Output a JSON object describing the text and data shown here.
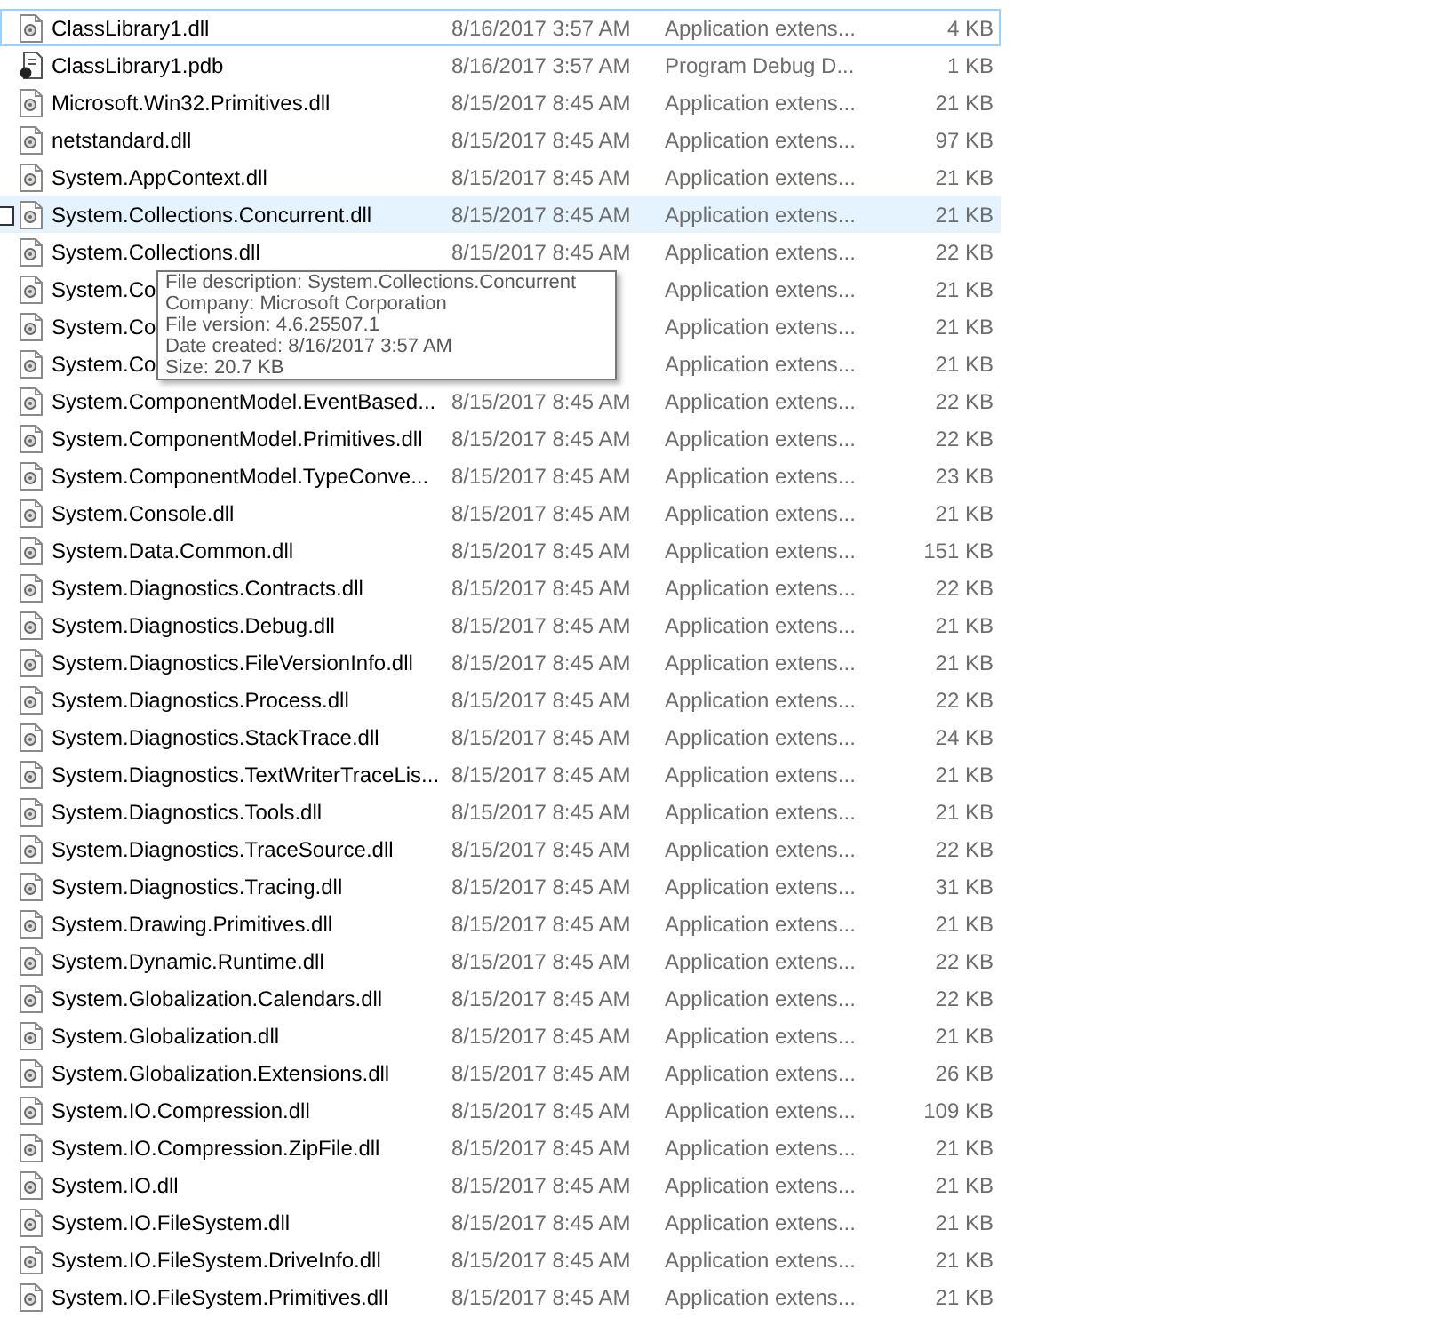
{
  "files": [
    {
      "kind": "dll",
      "name": "ClassLibrary1.dll",
      "date": "8/16/2017 3:57 AM",
      "type": "Application extens...",
      "size": "4 KB",
      "focused": true,
      "hovered": false
    },
    {
      "kind": "pdb",
      "name": "ClassLibrary1.pdb",
      "date": "8/16/2017 3:57 AM",
      "type": "Program Debug D...",
      "size": "1 KB",
      "focused": false,
      "hovered": false
    },
    {
      "kind": "dll",
      "name": "Microsoft.Win32.Primitives.dll",
      "date": "8/15/2017 8:45 AM",
      "type": "Application extens...",
      "size": "21 KB",
      "focused": false,
      "hovered": false
    },
    {
      "kind": "dll",
      "name": "netstandard.dll",
      "date": "8/15/2017 8:45 AM",
      "type": "Application extens...",
      "size": "97 KB",
      "focused": false,
      "hovered": false
    },
    {
      "kind": "dll",
      "name": "System.AppContext.dll",
      "date": "8/15/2017 8:45 AM",
      "type": "Application extens...",
      "size": "21 KB",
      "focused": false,
      "hovered": false
    },
    {
      "kind": "dll",
      "name": "System.Collections.Concurrent.dll",
      "date": "8/15/2017 8:45 AM",
      "type": "Application extens...",
      "size": "21 KB",
      "focused": false,
      "hovered": true
    },
    {
      "kind": "dll",
      "name": "System.Collections.dll",
      "date": "8/15/2017 8:45 AM",
      "type": "Application extens...",
      "size": "22 KB",
      "focused": false,
      "hovered": false
    },
    {
      "kind": "dll",
      "name": "System.Co",
      "type": "Application extens...",
      "size": "21 KB",
      "focused": false,
      "hovered": false
    },
    {
      "kind": "dll",
      "name": "System.Co",
      "type": "Application extens...",
      "size": "21 KB",
      "focused": false,
      "hovered": false
    },
    {
      "kind": "dll",
      "name": "System.Co",
      "type": "Application extens...",
      "size": "21 KB",
      "focused": false,
      "hovered": false
    },
    {
      "kind": "dll",
      "name": "System.ComponentModel.EventBased...",
      "date": "8/15/2017 8:45 AM",
      "type": "Application extens...",
      "size": "22 KB",
      "focused": false,
      "hovered": false
    },
    {
      "kind": "dll",
      "name": "System.ComponentModel.Primitives.dll",
      "date": "8/15/2017 8:45 AM",
      "type": "Application extens...",
      "size": "22 KB",
      "focused": false,
      "hovered": false
    },
    {
      "kind": "dll",
      "name": "System.ComponentModel.TypeConve...",
      "date": "8/15/2017 8:45 AM",
      "type": "Application extens...",
      "size": "23 KB",
      "focused": false,
      "hovered": false
    },
    {
      "kind": "dll",
      "name": "System.Console.dll",
      "date": "8/15/2017 8:45 AM",
      "type": "Application extens...",
      "size": "21 KB",
      "focused": false,
      "hovered": false
    },
    {
      "kind": "dll",
      "name": "System.Data.Common.dll",
      "date": "8/15/2017 8:45 AM",
      "type": "Application extens...",
      "size": "151 KB",
      "focused": false,
      "hovered": false
    },
    {
      "kind": "dll",
      "name": "System.Diagnostics.Contracts.dll",
      "date": "8/15/2017 8:45 AM",
      "type": "Application extens...",
      "size": "22 KB",
      "focused": false,
      "hovered": false
    },
    {
      "kind": "dll",
      "name": "System.Diagnostics.Debug.dll",
      "date": "8/15/2017 8:45 AM",
      "type": "Application extens...",
      "size": "21 KB",
      "focused": false,
      "hovered": false
    },
    {
      "kind": "dll",
      "name": "System.Diagnostics.FileVersionInfo.dll",
      "date": "8/15/2017 8:45 AM",
      "type": "Application extens...",
      "size": "21 KB",
      "focused": false,
      "hovered": false
    },
    {
      "kind": "dll",
      "name": "System.Diagnostics.Process.dll",
      "date": "8/15/2017 8:45 AM",
      "type": "Application extens...",
      "size": "22 KB",
      "focused": false,
      "hovered": false
    },
    {
      "kind": "dll",
      "name": "System.Diagnostics.StackTrace.dll",
      "date": "8/15/2017 8:45 AM",
      "type": "Application extens...",
      "size": "24 KB",
      "focused": false,
      "hovered": false
    },
    {
      "kind": "dll",
      "name": "System.Diagnostics.TextWriterTraceLis...",
      "date": "8/15/2017 8:45 AM",
      "type": "Application extens...",
      "size": "21 KB",
      "focused": false,
      "hovered": false
    },
    {
      "kind": "dll",
      "name": "System.Diagnostics.Tools.dll",
      "date": "8/15/2017 8:45 AM",
      "type": "Application extens...",
      "size": "21 KB",
      "focused": false,
      "hovered": false
    },
    {
      "kind": "dll",
      "name": "System.Diagnostics.TraceSource.dll",
      "date": "8/15/2017 8:45 AM",
      "type": "Application extens...",
      "size": "22 KB",
      "focused": false,
      "hovered": false
    },
    {
      "kind": "dll",
      "name": "System.Diagnostics.Tracing.dll",
      "date": "8/15/2017 8:45 AM",
      "type": "Application extens...",
      "size": "31 KB",
      "focused": false,
      "hovered": false
    },
    {
      "kind": "dll",
      "name": "System.Drawing.Primitives.dll",
      "date": "8/15/2017 8:45 AM",
      "type": "Application extens...",
      "size": "21 KB",
      "focused": false,
      "hovered": false
    },
    {
      "kind": "dll",
      "name": "System.Dynamic.Runtime.dll",
      "date": "8/15/2017 8:45 AM",
      "type": "Application extens...",
      "size": "22 KB",
      "focused": false,
      "hovered": false
    },
    {
      "kind": "dll",
      "name": "System.Globalization.Calendars.dll",
      "date": "8/15/2017 8:45 AM",
      "type": "Application extens...",
      "size": "22 KB",
      "focused": false,
      "hovered": false
    },
    {
      "kind": "dll",
      "name": "System.Globalization.dll",
      "date": "8/15/2017 8:45 AM",
      "type": "Application extens...",
      "size": "21 KB",
      "focused": false,
      "hovered": false
    },
    {
      "kind": "dll",
      "name": "System.Globalization.Extensions.dll",
      "date": "8/15/2017 8:45 AM",
      "type": "Application extens...",
      "size": "26 KB",
      "focused": false,
      "hovered": false
    },
    {
      "kind": "dll",
      "name": "System.IO.Compression.dll",
      "date": "8/15/2017 8:45 AM",
      "type": "Application extens...",
      "size": "109 KB",
      "focused": false,
      "hovered": false
    },
    {
      "kind": "dll",
      "name": "System.IO.Compression.ZipFile.dll",
      "date": "8/15/2017 8:45 AM",
      "type": "Application extens...",
      "size": "21 KB",
      "focused": false,
      "hovered": false
    },
    {
      "kind": "dll",
      "name": "System.IO.dll",
      "date": "8/15/2017 8:45 AM",
      "type": "Application extens...",
      "size": "21 KB",
      "focused": false,
      "hovered": false
    },
    {
      "kind": "dll",
      "name": "System.IO.FileSystem.dll",
      "date": "8/15/2017 8:45 AM",
      "type": "Application extens...",
      "size": "21 KB",
      "focused": false,
      "hovered": false
    },
    {
      "kind": "dll",
      "name": "System.IO.FileSystem.DriveInfo.dll",
      "date": "8/15/2017 8:45 AM",
      "type": "Application extens...",
      "size": "21 KB",
      "focused": false,
      "hovered": false
    },
    {
      "kind": "dll",
      "name": "System.IO.FileSystem.Primitives.dll",
      "date": "8/15/2017 8:45 AM",
      "type": "Application extens...",
      "size": "21 KB",
      "focused": false,
      "hovered": false
    }
  ],
  "tooltip": {
    "lines": [
      "File description: System.Collections.Concurrent",
      "Company: Microsoft Corporation",
      "File version: 4.6.25507.1",
      "Date created: 8/16/2017 3:57 AM",
      "Size: 20.7 KB"
    ]
  }
}
